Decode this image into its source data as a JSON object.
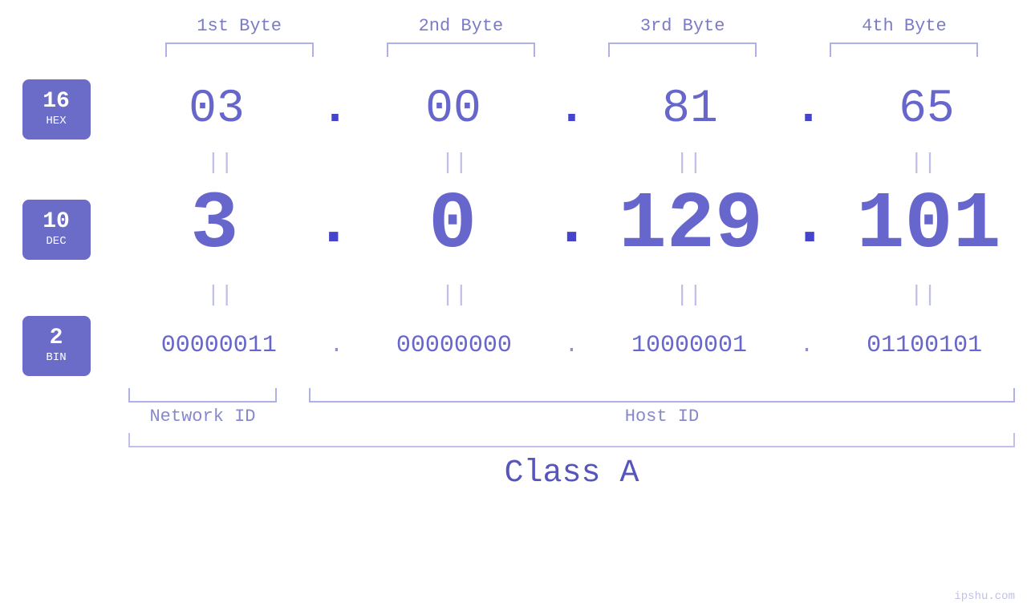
{
  "bytes": {
    "headers": [
      "1st Byte",
      "2nd Byte",
      "3rd Byte",
      "4th Byte"
    ],
    "hex": [
      "03",
      "00",
      "81",
      "65"
    ],
    "dec": [
      "3",
      "0",
      "129",
      "101"
    ],
    "bin": [
      "00000011",
      "00000000",
      "10000001",
      "01100101"
    ]
  },
  "bases": [
    {
      "number": "16",
      "label": "HEX"
    },
    {
      "number": "10",
      "label": "DEC"
    },
    {
      "number": "2",
      "label": "BIN"
    }
  ],
  "labels": {
    "network_id": "Network ID",
    "host_id": "Host ID",
    "class": "Class A",
    "watermark": "ipshu.com"
  },
  "equals": "||"
}
